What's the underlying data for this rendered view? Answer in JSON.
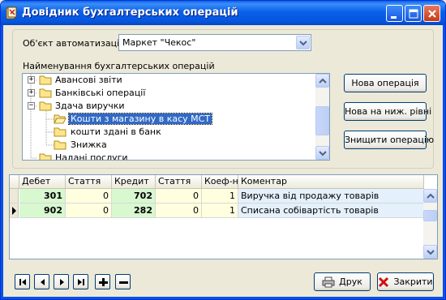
{
  "window": {
    "title": "Довідник бухгалтерських операцій"
  },
  "object": {
    "label": "Об'єкт автоматизації",
    "value": "Маркет \"Чекос\""
  },
  "operations": {
    "label": "Найменування бухгалтерських операцій",
    "tree": [
      {
        "label": "Авансові звіти",
        "level": 0,
        "expander": "+"
      },
      {
        "label": "Банківські операції",
        "level": 0,
        "expander": "+"
      },
      {
        "label": "Здача виручки",
        "level": 0,
        "expander": "−"
      },
      {
        "label": "Кошти з магазину в касу МСТ",
        "level": 1,
        "selected": true
      },
      {
        "label": "кошти здані в банк",
        "level": 1
      },
      {
        "label": "Знижка",
        "level": 1
      },
      {
        "label": "Надані послуги",
        "level": 0
      }
    ]
  },
  "buttons": {
    "new_operation": "Нова операція",
    "new_lower_level": "Нова на ниж. рівні",
    "delete_operation": "Знищити операцію",
    "print": "Друк",
    "close": "Закрити"
  },
  "grid": {
    "columns": [
      "Дебет",
      "Стаття",
      "Кредит",
      "Стаття",
      "Коеф-нт",
      "Коментар"
    ],
    "rows": [
      {
        "debit": "301",
        "article1": "0",
        "credit": "702",
        "article2": "0",
        "coef": "1",
        "comment": "Виручка від продажу товарів",
        "current": false
      },
      {
        "debit": "902",
        "article1": "0",
        "credit": "282",
        "article2": "0",
        "coef": "1",
        "comment": "Списана собівартість товарів",
        "current": true
      }
    ]
  },
  "colors": {
    "titlebar": "#0A5FE8",
    "selection": "#316AC5",
    "debit_credit_bg": "#D8F8D0",
    "article_bg": "#FFFFE0"
  },
  "icons": {
    "window": "app-book-icon",
    "nav": [
      "first-record-icon",
      "prior-record-icon",
      "next-record-icon",
      "last-record-icon",
      "insert-record-icon",
      "delete-record-icon"
    ],
    "print": "printer-icon",
    "close": "red-x-icon"
  }
}
